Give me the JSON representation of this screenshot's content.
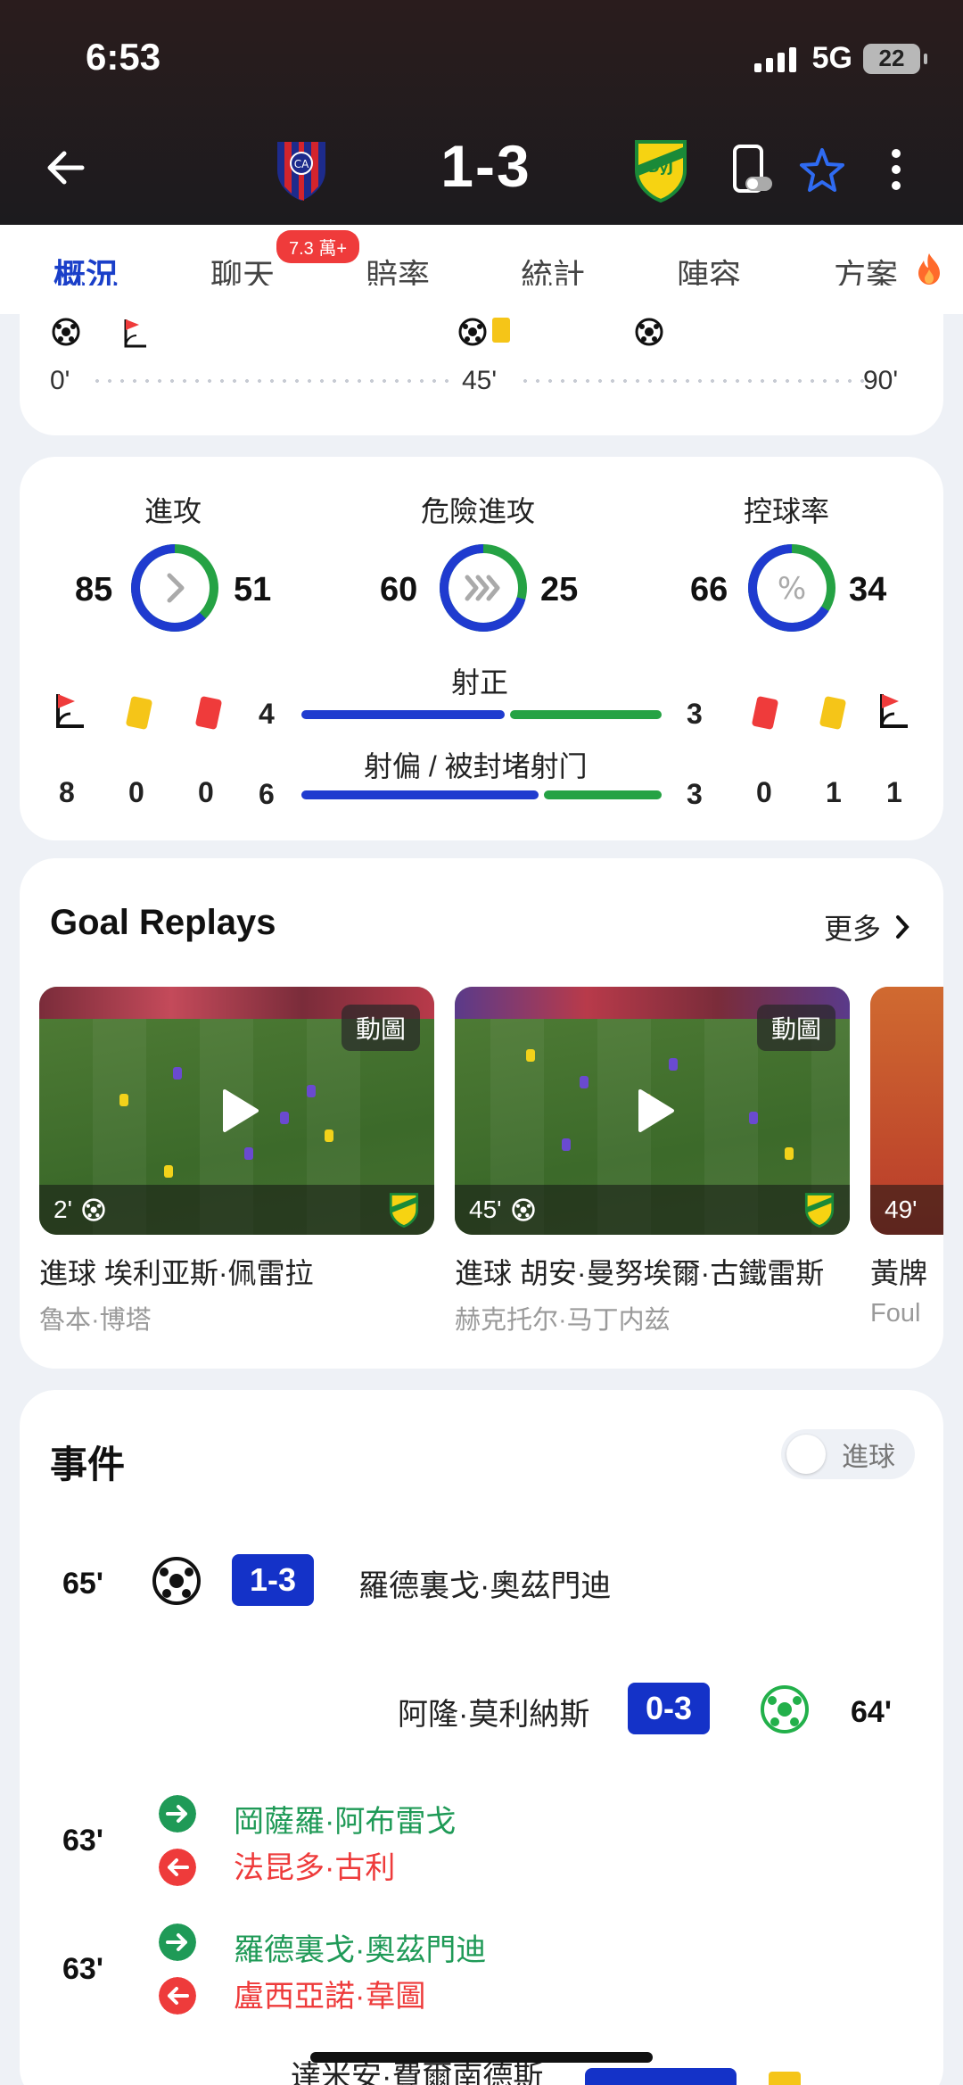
{
  "status_bar": {
    "time": "6:53",
    "network": "5G",
    "battery": "22"
  },
  "match": {
    "score": "1-3"
  },
  "tabs": [
    {
      "label": "概況"
    },
    {
      "label": "聊天"
    },
    {
      "label": "賠率"
    },
    {
      "label": "統計"
    },
    {
      "label": "陣容"
    },
    {
      "label": "方案"
    }
  ],
  "chat_badge": "7.3 萬+",
  "timeline": {
    "start": "0'",
    "half": "45'",
    "end": "90'"
  },
  "stats": {
    "attack": {
      "title": "進攻",
      "home": "85",
      "away": "51",
      "home_share": 0.625
    },
    "dangerous_attack": {
      "title": "危險進攻",
      "home": "60",
      "away": "25",
      "home_share": 0.706
    },
    "possession": {
      "title": "控球率",
      "home": "66",
      "away": "34",
      "home_share": 0.66
    },
    "shots_on_target": {
      "label": "射正",
      "home": "4",
      "away": "3"
    },
    "shots_off": {
      "label": "射偏 / 被封堵射门",
      "home": "6",
      "away": "3"
    },
    "home_cards_row": {
      "corners": "8",
      "yellow": "0",
      "red": "0"
    },
    "away_cards_row": {
      "red": "0",
      "yellow": "1",
      "corners": "1"
    }
  },
  "replays": {
    "title": "Goal Replays",
    "more": "更多",
    "items": [
      {
        "badge": "動圖",
        "minute": "2'",
        "caption": "進球 埃利亚斯·佩雷拉",
        "sub": "魯本·博塔"
      },
      {
        "badge": "動圖",
        "minute": "45'",
        "caption": "進球 胡安·曼努埃爾·古鐵雷斯",
        "sub": "赫克托尔·马丁内兹"
      },
      {
        "badge": "",
        "minute": "49'",
        "caption": "黃牌",
        "sub": "Foul"
      }
    ]
  },
  "events": {
    "title": "事件",
    "toggle_label": "進球",
    "items": [
      {
        "minute": "65'",
        "score": "1-3",
        "player": "羅德裏戈·奧茲門迪"
      },
      {
        "minute": "64'",
        "score": "0-3",
        "player": "阿隆·莫利納斯"
      },
      {
        "minute": "63'",
        "in": "岡薩羅·阿布雷戈",
        "out": "法昆多·古利"
      },
      {
        "minute": "63'",
        "in": "羅德裏戈·奧茲門迪",
        "out": "盧西亞諾·韋圖"
      },
      {
        "partial": "達米安·費爾南德斯"
      }
    ]
  },
  "colors": {
    "home_blue": "#1f3bcf",
    "away_green": "#25a244",
    "accent": "#1a3fc9"
  }
}
